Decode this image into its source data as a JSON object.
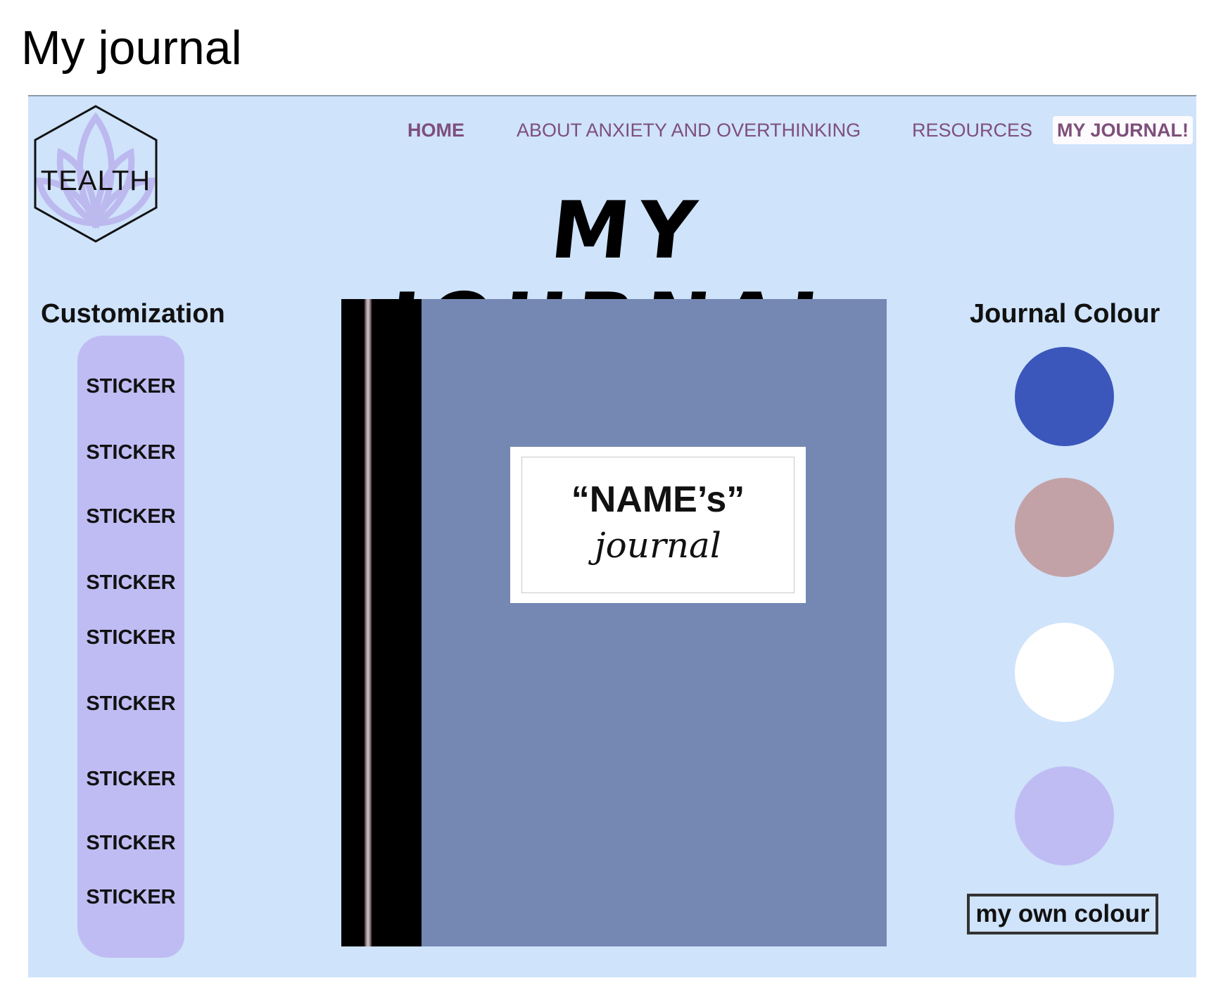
{
  "slide": {
    "title": "My journal"
  },
  "brand": {
    "logo_text": "TEALTH",
    "logo_icon": "lotus-hexagon-icon"
  },
  "nav": {
    "items": [
      {
        "label": "HOME"
      },
      {
        "label": "ABOUT ANXIETY AND OVERTHINKING"
      },
      {
        "label": "RESOURCES"
      },
      {
        "label": "MY JOURNAL!"
      }
    ]
  },
  "hero": {
    "title": "MY JOURNAL"
  },
  "customization": {
    "heading": "Customization",
    "stickers": [
      "STICKER",
      "STICKER",
      "STICKER",
      "STICKER",
      "STICKER",
      "STICKER",
      "STICKER",
      "STICKER",
      "STICKER"
    ]
  },
  "journal": {
    "cover_color": "#7588b3",
    "label_name": "“NAME’s”",
    "label_sub": "journal"
  },
  "colours": {
    "heading": "Journal Colour",
    "swatches": [
      "#3b57bb",
      "#c2a2a6",
      "#ffffff",
      "#bfbcf3"
    ],
    "own_colour_label": "my own colour"
  }
}
